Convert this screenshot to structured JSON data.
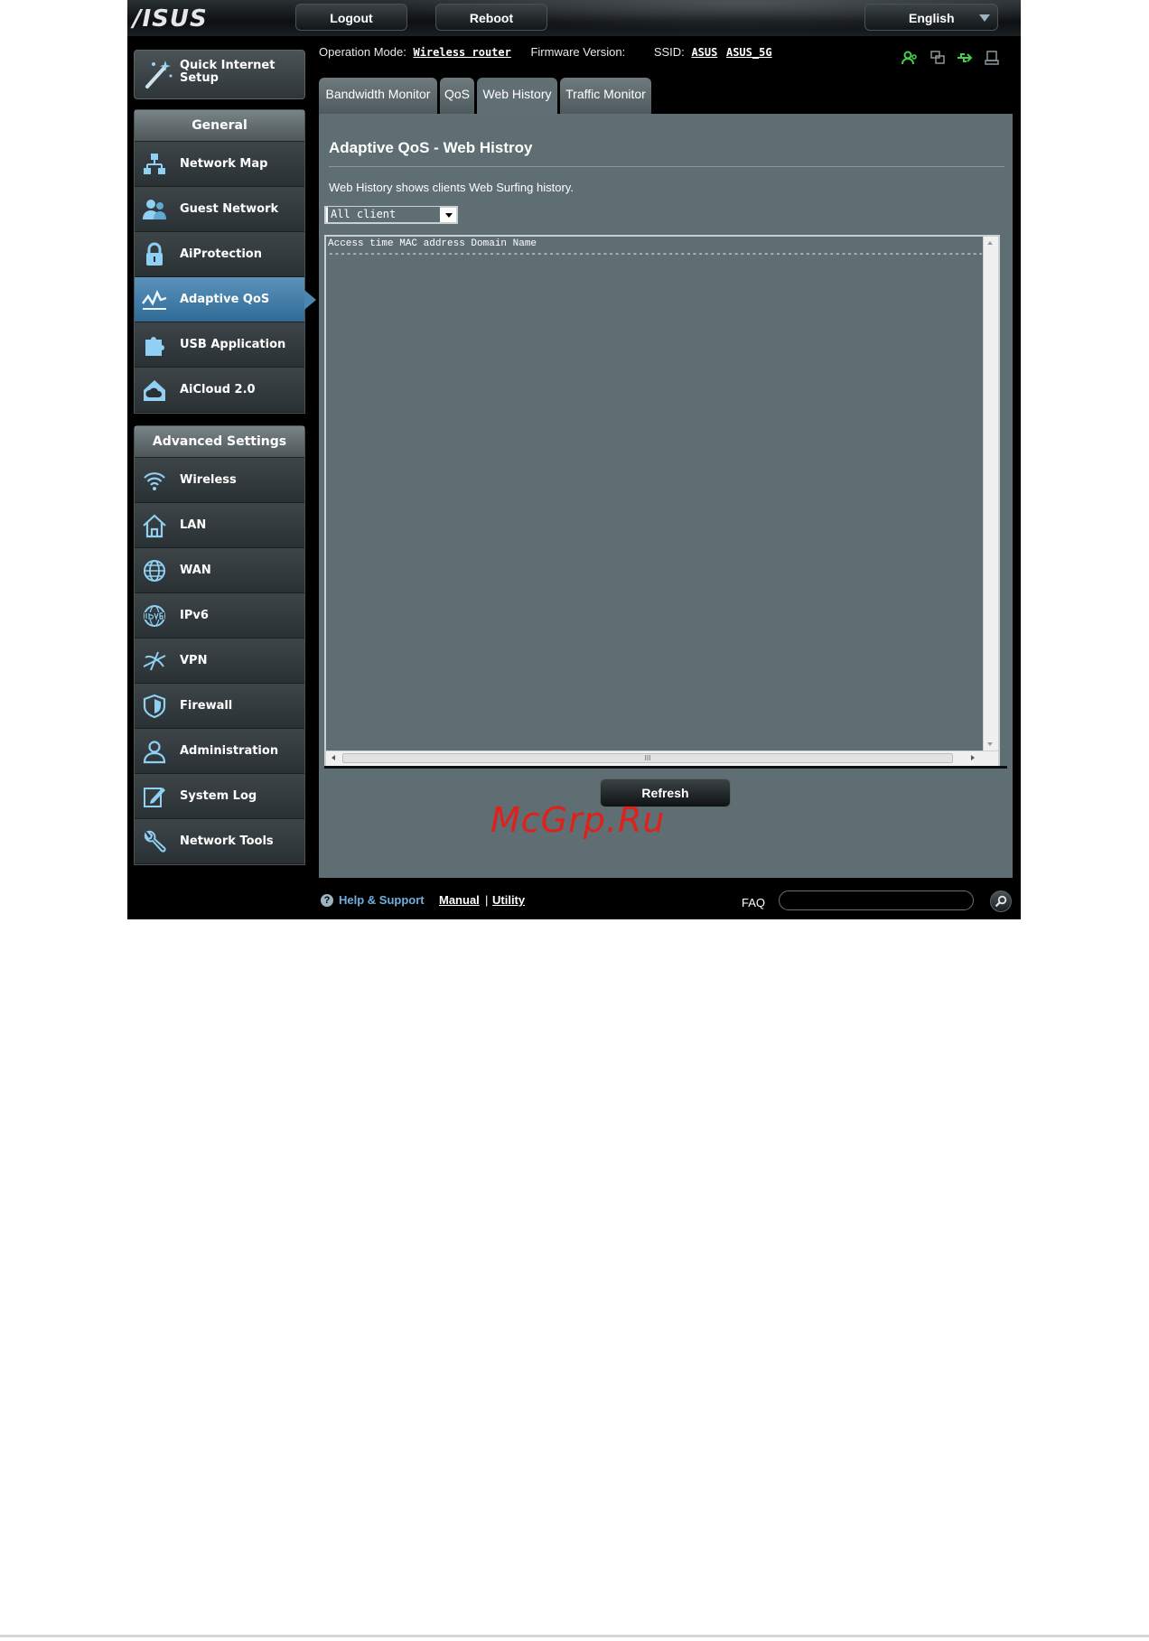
{
  "header": {
    "logo": "/ISUS",
    "logout_label": "Logout",
    "reboot_label": "Reboot",
    "language": "English"
  },
  "status": {
    "operation_mode_label": "Operation Mode:",
    "operation_mode_value": "Wireless router",
    "firmware_label": "Firmware Version:",
    "ssid_label": "SSID:",
    "ssid_1": "ASUS",
    "ssid_2": "ASUS_5G"
  },
  "sidebar": {
    "quick_setup": "Quick Internet Setup",
    "general_title": "General",
    "general_items": [
      {
        "label": "Network Map"
      },
      {
        "label": "Guest Network"
      },
      {
        "label": "AiProtection"
      },
      {
        "label": "Adaptive QoS"
      },
      {
        "label": "USB Application"
      },
      {
        "label": "AiCloud 2.0"
      }
    ],
    "advanced_title": "Advanced Settings",
    "advanced_items": [
      {
        "label": "Wireless"
      },
      {
        "label": "LAN"
      },
      {
        "label": "WAN"
      },
      {
        "label": "IPv6"
      },
      {
        "label": "VPN"
      },
      {
        "label": "Firewall"
      },
      {
        "label": "Administration"
      },
      {
        "label": "System Log"
      },
      {
        "label": "Network Tools"
      }
    ]
  },
  "tabs": [
    {
      "label": "Bandwidth Monitor"
    },
    {
      "label": "QoS"
    },
    {
      "label": "Web History"
    },
    {
      "label": "Traffic Monitor"
    }
  ],
  "main": {
    "title": "Adaptive QoS - Web Histroy",
    "description": "Web History shows clients Web Surfing history.",
    "client_select": "All client",
    "history_header": "Access time MAC address Domain Name",
    "history_divider": "------------------------------------------------------------------------------------------------------------------",
    "scroll_thumb_grip": "III",
    "refresh_label": "Refresh",
    "watermark": "McGrp.Ru"
  },
  "footer": {
    "help_label": "Help & Support",
    "manual_label": "Manual",
    "separator": "|",
    "utility_label": "Utility",
    "faq_label": "FAQ",
    "faq_placeholder": ""
  },
  "colors": {
    "active_menu": "#4b86b1",
    "content_bg": "#5e6e73",
    "watermark": "#e0211b",
    "help_link": "#6fb0df"
  }
}
